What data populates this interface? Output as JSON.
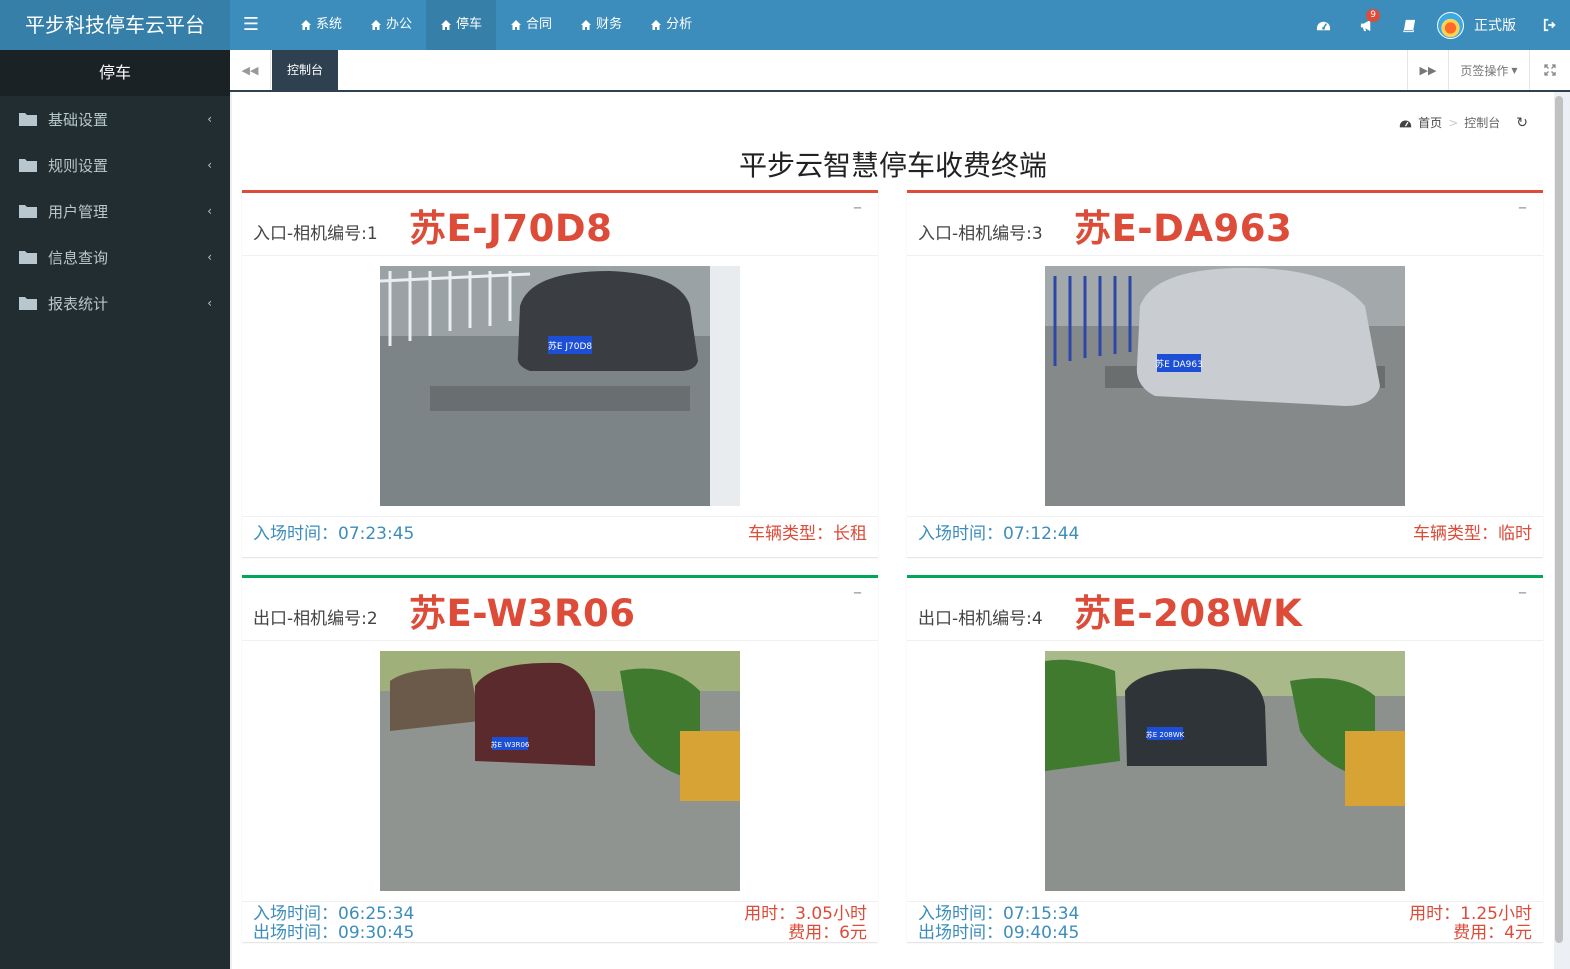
{
  "app": {
    "title": "平步科技停车云平台"
  },
  "topnav": {
    "items": [
      {
        "label": "系统",
        "active": false
      },
      {
        "label": "办公",
        "active": false
      },
      {
        "label": "停车",
        "active": true
      },
      {
        "label": "合同",
        "active": false
      },
      {
        "label": "财务",
        "active": false
      },
      {
        "label": "分析",
        "active": false
      }
    ],
    "notification_count": "9",
    "user_label": "正式版"
  },
  "sidebar": {
    "header": "停车",
    "items": [
      {
        "label": "基础设置"
      },
      {
        "label": "规则设置"
      },
      {
        "label": "用户管理"
      },
      {
        "label": "信息查询"
      },
      {
        "label": "报表统计"
      }
    ]
  },
  "tabbar": {
    "active_tab": "控制台",
    "tab_ops": "页签操作"
  },
  "breadcrumb": {
    "home": "首页",
    "current": "控制台"
  },
  "page": {
    "title": "平步云智慧停车收费终端"
  },
  "cards": [
    {
      "camera": "入口-相机编号:1",
      "plate": "苏E-J70D8",
      "line1_left": "入场时间：07:23:45",
      "line1_right": "车辆类型：长租",
      "line2_left": "",
      "line2_right": "",
      "plate_text_on_photo": "苏E J70D8",
      "car_color": "#3a3d42"
    },
    {
      "camera": "入口-相机编号:3",
      "plate": "苏E-DA963",
      "line1_left": "入场时间：07:12:44",
      "line1_right": "车辆类型：临时",
      "line2_left": "",
      "line2_right": "",
      "plate_text_on_photo": "苏E DA963",
      "car_color": "#c9ccd0"
    },
    {
      "camera": "出口-相机编号:2",
      "plate": "苏E-W3R06",
      "line1_left": "入场时间：06:25:34",
      "line1_right": "用时：3.05小时",
      "line2_left": "出场时间：09:30:45",
      "line2_right": "费用：6元",
      "plate_text_on_photo": "苏E W3R06",
      "car_color": "#5a2a2c"
    },
    {
      "camera": "出口-相机编号:4",
      "plate": "苏E-208WK",
      "line1_left": "入场时间：07:15:34",
      "line1_right": "用时：1.25小时",
      "line2_left": "出场时间：09:40:45",
      "line2_right": "费用：4元",
      "plate_text_on_photo": "苏E 208WK",
      "car_color": "#2e3438"
    }
  ],
  "colors": {
    "header": "#3c8dbc",
    "sidebar": "#222d32",
    "entry_border": "#dd4b39",
    "exit_border": "#00a65a",
    "plate_red": "#dd4b39",
    "time_blue": "#3c8dbc"
  }
}
